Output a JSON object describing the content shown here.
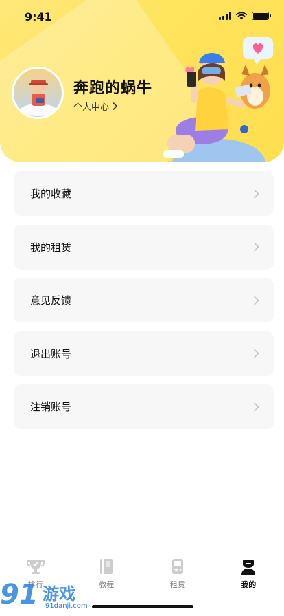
{
  "status_bar": {
    "time": "9:41"
  },
  "profile": {
    "name": "奔跑的蜗牛",
    "link_label": "个人中心"
  },
  "menu": [
    {
      "label": "我的收藏"
    },
    {
      "label": "我的租赁"
    },
    {
      "label": "意见反馈"
    },
    {
      "label": "退出账号"
    },
    {
      "label": "注销账号"
    }
  ],
  "tabs": [
    {
      "label": "排行",
      "icon": "trophy-icon",
      "active": false
    },
    {
      "label": "教程",
      "icon": "book-icon",
      "active": false
    },
    {
      "label": "租赁",
      "icon": "gamepad-icon",
      "active": false
    },
    {
      "label": "我的",
      "icon": "user-icon",
      "active": true
    }
  ],
  "watermark": {
    "site": "91danji.com",
    "brand": "91游戏"
  },
  "colors": {
    "header": "#ffe45e",
    "card": "#f7f7f7",
    "active_tab": "#111111",
    "inactive_tab": "#cccccc"
  }
}
